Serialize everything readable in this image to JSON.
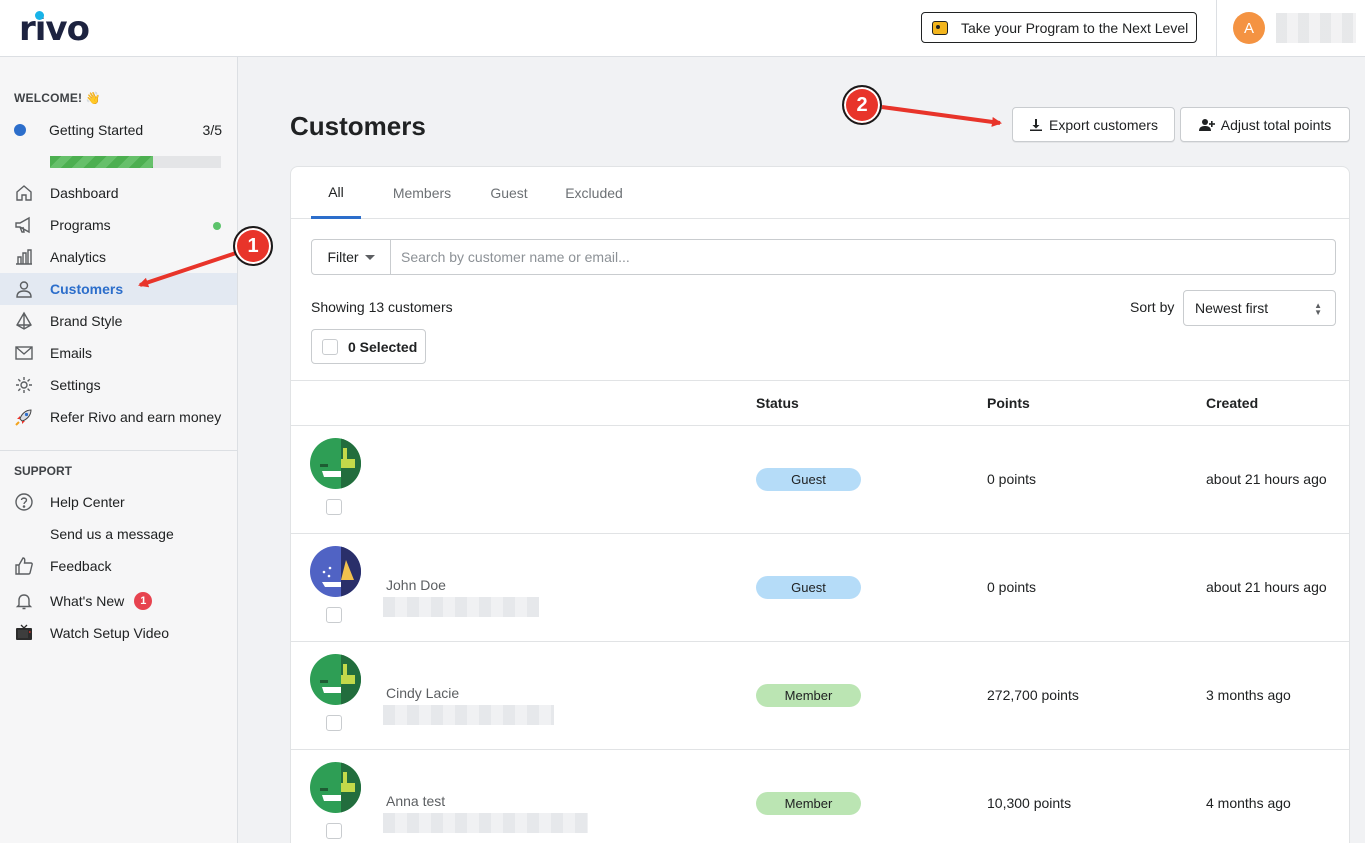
{
  "brand": {
    "logo_text": "rivo"
  },
  "topbar": {
    "promo_label": "Take your Program to the Next Level",
    "user_initial": "A"
  },
  "sidebar": {
    "welcome": "WELCOME! 👋",
    "getting_started": {
      "label": "Getting Started",
      "count": "3/5",
      "progress": 0.6
    },
    "items": [
      {
        "label": "Dashboard",
        "icon": "home-icon"
      },
      {
        "label": "Programs",
        "icon": "megaphone-icon"
      },
      {
        "label": "Analytics",
        "icon": "bar-chart-icon"
      },
      {
        "label": "Customers",
        "icon": "user-icon",
        "active": true
      },
      {
        "label": "Brand Style",
        "icon": "brush-icon"
      },
      {
        "label": "Emails",
        "icon": "envelope-icon"
      },
      {
        "label": "Settings",
        "icon": "gear-icon"
      },
      {
        "label": "Refer Rivo and earn money",
        "icon": "rocket-icon"
      }
    ],
    "support_heading": "SUPPORT",
    "support_items": [
      {
        "label": "Help Center",
        "icon": "question-icon"
      },
      {
        "label": "Send us a message",
        "icon": ""
      },
      {
        "label": "Feedback",
        "icon": "thumbs-up-icon"
      },
      {
        "label": "What's New",
        "icon": "bell-icon",
        "badge": "1"
      },
      {
        "label": "Watch Setup Video",
        "icon": "tv-icon"
      }
    ]
  },
  "main": {
    "title": "Customers",
    "export_label": "Export customers",
    "adjust_label": "Adjust total points",
    "tabs": [
      "All",
      "Members",
      "Guest",
      "Excluded"
    ],
    "filter_label": "Filter",
    "search_placeholder": "Search by customer name or email...",
    "showing": "Showing 13 customers",
    "sort_label": "Sort by",
    "sort_value": "Newest first",
    "selected_label": "0 Selected",
    "columns": {
      "status": "Status",
      "points": "Points",
      "created": "Created"
    },
    "rows": [
      {
        "name": "",
        "status": "Guest",
        "points": "0 points",
        "created": "about 21 hours ago"
      },
      {
        "name": "John Doe",
        "status": "Guest",
        "points": "0 points",
        "created": "about 21 hours ago"
      },
      {
        "name": "Cindy Lacie",
        "status": "Member",
        "points": "272,700 points",
        "created": "3 months ago"
      },
      {
        "name": "Anna test",
        "status": "Member",
        "points": "10,300 points",
        "created": "4 months ago"
      }
    ]
  },
  "annotations": [
    "1",
    "2"
  ],
  "colors": {
    "accent": "#2c6ecb",
    "guest": "#b5dcf8",
    "member": "#bbe5b3",
    "annotation": "#e8342a"
  }
}
